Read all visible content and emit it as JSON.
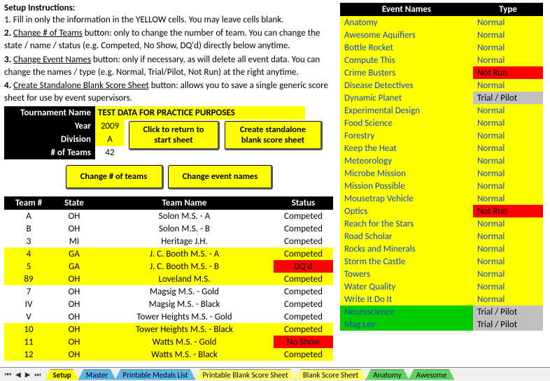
{
  "instructions": {
    "title": "Setup Instructions:",
    "l1": "1. Fill in only the information in the YELLOW cells.  You may leave cells blank.",
    "l2a": "2.",
    "l2u": "Change # of Teams",
    "l2b": " button: only to change the number of team.  You can change the state / name / status (e.g. Competed, No Show, DQ'd) directly below anytime.",
    "l3a": "3.",
    "l3u": "Change Event Names",
    "l3b": " button: only if necessary, as will delete all event data.  You can change the names / type (e.g. Normal, Trial/Pilot, Not Run) at the right anytime.",
    "l4a": "4.",
    "l4u": "Create Standalone Blank Score Sheet",
    "l4b": " button:  allows you to save a single generic score sheet for use by event supervisors."
  },
  "tourn": {
    "labels": {
      "name": "Tournament Name",
      "year": "Year",
      "division": "Division",
      "teams": "# of Teams"
    },
    "vals": {
      "name": "TEST DATA FOR PRACTICE PURPOSES",
      "year": "2009",
      "division": "A",
      "teams": "42"
    }
  },
  "buttons": {
    "return1": "Click to return to",
    "return2": "start sheet",
    "blank1": "Create standalone",
    "blank2": "blank score sheet",
    "changeTeams": "Change # of teams",
    "changeEvents": "Change event names"
  },
  "teamHeaders": {
    "num": "Team #",
    "state": "State",
    "name": "Team Name",
    "status": "Status"
  },
  "teams": [
    {
      "num": "A",
      "state": "OH",
      "name": "Solon M.S. - A",
      "status": "Competed",
      "y": false
    },
    {
      "num": "B",
      "state": "OH",
      "name": "Solon M.S. - B",
      "status": "Competed",
      "y": false
    },
    {
      "num": "3",
      "state": "MI",
      "name": "Heritage J.H.",
      "status": "Competed",
      "y": false
    },
    {
      "num": "4",
      "state": "GA",
      "name": "J. C. Booth M.S. - A",
      "status": "Competed",
      "y": true
    },
    {
      "num": "5",
      "state": "GA",
      "name": "J. C. Booth M.S. - B",
      "status": "DQ'd",
      "y": true,
      "sred": true
    },
    {
      "num": "89",
      "state": "OH",
      "name": "Loveland M.S.",
      "status": "Competed",
      "y": true
    },
    {
      "num": "7",
      "state": "OH",
      "name": "Magsig M.S. - Gold",
      "status": "Competed",
      "y": false
    },
    {
      "num": "IV",
      "state": "OH",
      "name": "Magsig M.S. - Black",
      "status": "Competed",
      "y": false
    },
    {
      "num": "V",
      "state": "OH",
      "name": "Tower Heights M.S. - Gold",
      "status": "Competed",
      "y": false
    },
    {
      "num": "10",
      "state": "OH",
      "name": "Tower Heights M.S. - Black",
      "status": "Competed",
      "y": true
    },
    {
      "num": "11",
      "state": "OH",
      "name": "Watts M.S. - Gold",
      "status": "No Show",
      "y": true,
      "sred": true
    },
    {
      "num": "12",
      "state": "OH",
      "name": "Watts M.S. - Black",
      "status": "Competed",
      "y": true
    }
  ],
  "eventHeaders": {
    "name": "Event Names",
    "type": "Type"
  },
  "events": [
    {
      "name": "Anatomy",
      "type": "Normal",
      "y": true
    },
    {
      "name": "Awesome Aquifiers",
      "type": "Normal",
      "y": true
    },
    {
      "name": "Bottle Rocket",
      "type": "Normal",
      "y": true
    },
    {
      "name": "Compute This",
      "type": "Normal",
      "y": true
    },
    {
      "name": "Crime Busters",
      "type": "Not Run",
      "y": true,
      "tred": true
    },
    {
      "name": "Disease Detectives",
      "type": "Normal",
      "y": true
    },
    {
      "name": "Dynamic Planet",
      "type": "Trial / Pilot",
      "y": true,
      "tsilver": true
    },
    {
      "name": "Experimental Design",
      "type": "Normal",
      "y": true
    },
    {
      "name": "Food Science",
      "type": "Normal",
      "y": true
    },
    {
      "name": "Forestry",
      "type": "Normal",
      "y": true
    },
    {
      "name": "Keep the Heat",
      "type": "Normal",
      "y": true
    },
    {
      "name": "Meteorology",
      "type": "Normal",
      "y": true
    },
    {
      "name": "Microbe Mission",
      "type": "Normal",
      "y": true
    },
    {
      "name": "Mission Possible",
      "type": "Normal",
      "y": true
    },
    {
      "name": "Mousetrap Vehicle",
      "type": "Normal",
      "y": true
    },
    {
      "name": "Optics",
      "type": "Not Run",
      "y": true,
      "tred": true
    },
    {
      "name": "Reach for the Stars",
      "type": "Normal",
      "y": true
    },
    {
      "name": "Road Scholar",
      "type": "Normal",
      "y": true
    },
    {
      "name": "Rocks and Minerals",
      "type": "Normal",
      "y": true
    },
    {
      "name": "Storm the Castle",
      "type": "Normal",
      "y": true
    },
    {
      "name": "Towers",
      "type": "Normal",
      "y": true
    },
    {
      "name": "Water Quality",
      "type": "Normal",
      "y": true
    },
    {
      "name": "Write It Do It",
      "type": "Normal",
      "y": true
    },
    {
      "name": "Neuroscience",
      "type": "Trial / Pilot",
      "y": false,
      "tsilver": true,
      "ngreen": true
    },
    {
      "name": "Mag Lev",
      "type": "Trial / Pilot",
      "y": false,
      "tsilver": true,
      "ngreen": true
    }
  ],
  "tabs": {
    "setup": "Setup",
    "master": "Master",
    "medals": "Printable Medals List",
    "pblank": "Printable Blank Score Sheet",
    "blank": "Blank Score Sheet",
    "anatomy": "Anatomy",
    "awesome": "Awesome"
  }
}
